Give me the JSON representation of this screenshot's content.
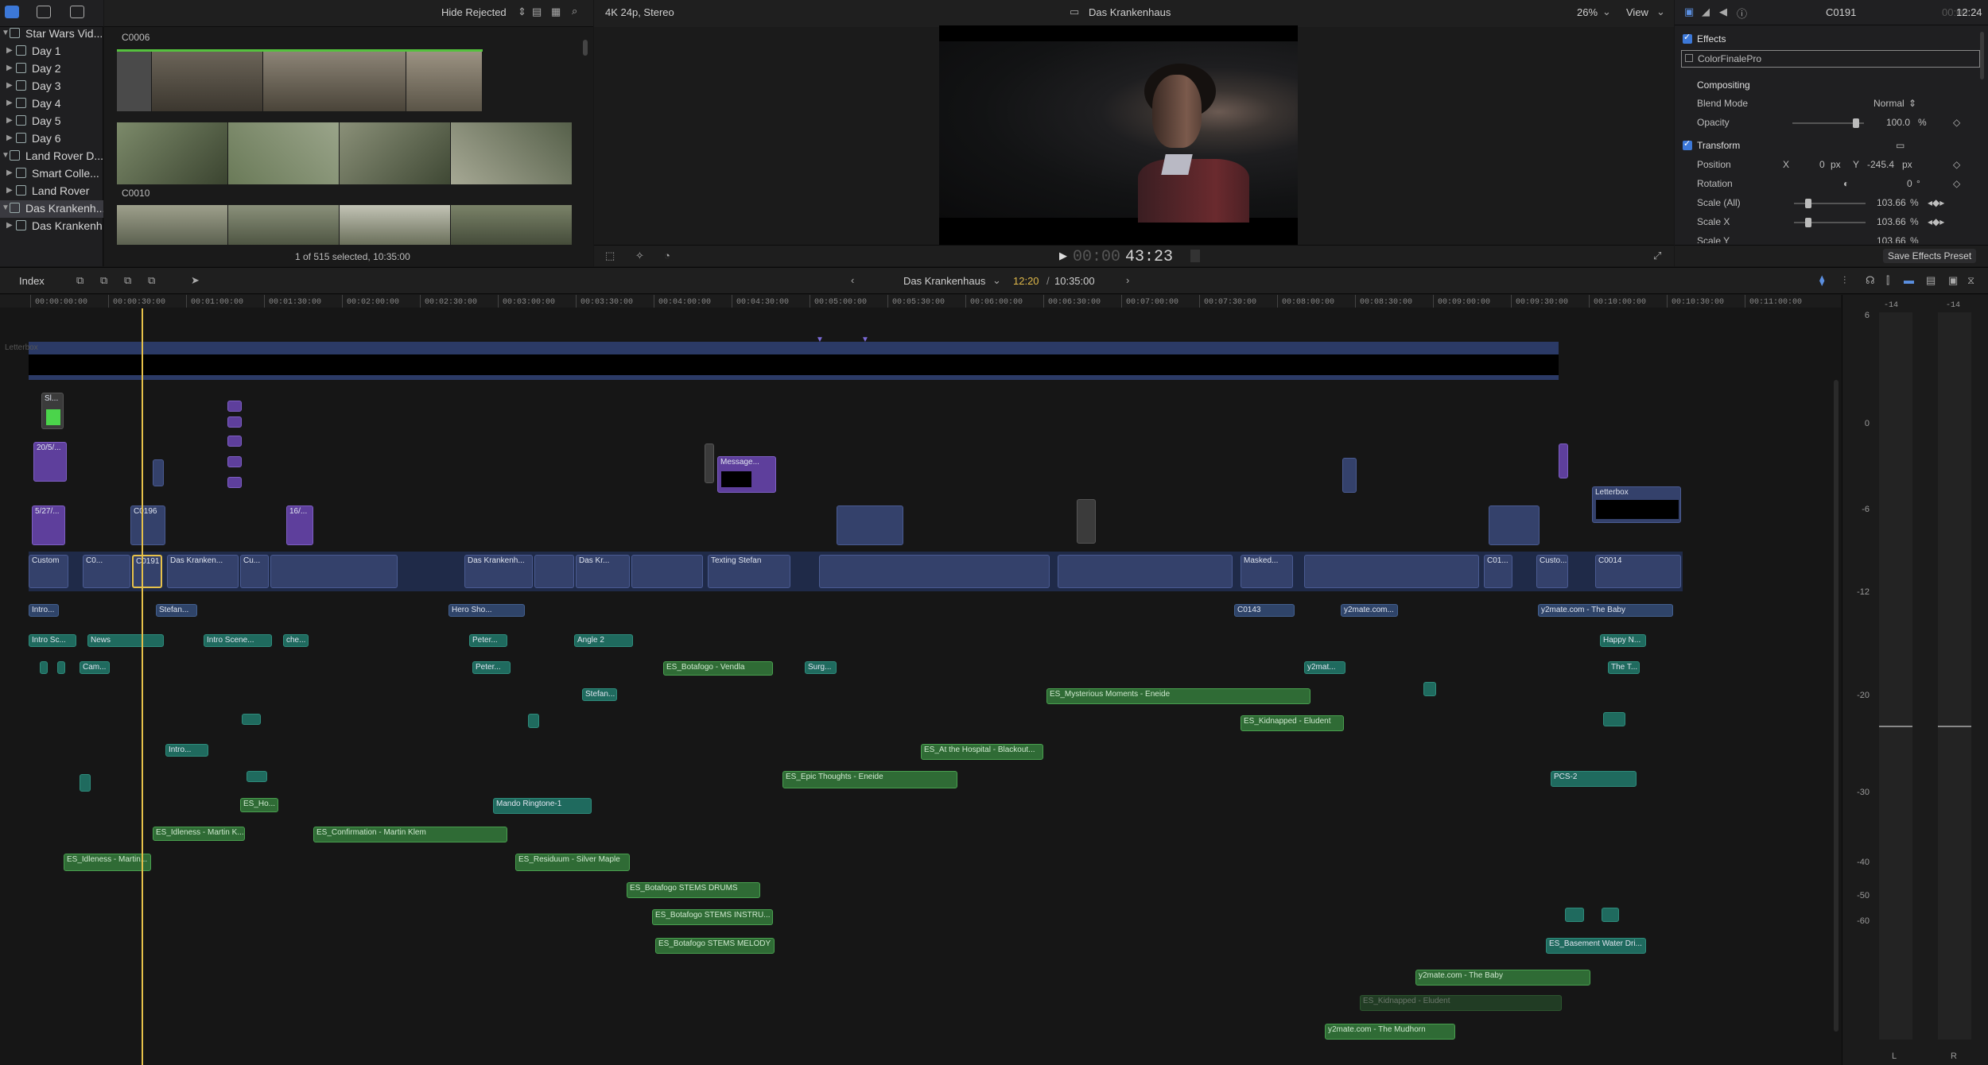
{
  "library": {
    "items": [
      {
        "label": "Star Wars Vid..."
      },
      {
        "label": "Day 1"
      },
      {
        "label": "Day 2"
      },
      {
        "label": "Day 3"
      },
      {
        "label": "Day 4"
      },
      {
        "label": "Day 5"
      },
      {
        "label": "Day 6"
      },
      {
        "label": "Land Rover D..."
      },
      {
        "label": "Smart Colle..."
      },
      {
        "label": "Land Rover"
      },
      {
        "label": "Das Krankenh..."
      },
      {
        "label": "Das Krankenh..."
      }
    ]
  },
  "browser": {
    "filter_label": "Hide Rejected",
    "clip1_name": "C0006",
    "clip2_name": "C0010",
    "status": "1 of 515 selected, 10:35:00"
  },
  "viewer": {
    "format": "4K 24p, Stereo",
    "title": "Das Krankenhaus",
    "zoom": "26%",
    "view_label": "View",
    "timecode_dim": "00:00",
    "timecode": "43:23"
  },
  "inspector": {
    "clip_name": "C0191",
    "duration_dim": "00:00",
    "duration": "12:24",
    "effects_label": "Effects",
    "effect_name": "ColorFinalePro",
    "compositing_label": "Compositing",
    "blend_mode_label": "Blend Mode",
    "blend_mode_value": "Normal",
    "opacity_label": "Opacity",
    "opacity_value": "100.0",
    "opacity_unit": "%",
    "transform_label": "Transform",
    "position_label": "Position",
    "pos_x_label": "X",
    "pos_x_value": "0",
    "pos_y_label": "Y",
    "pos_y_value": "-245.4",
    "pos_unit": "px",
    "rotation_label": "Rotation",
    "rotation_value": "0",
    "rotation_unit": "°",
    "scale_all_label": "Scale (All)",
    "scale_all_value": "103.66",
    "scale_x_label": "Scale X",
    "scale_x_value": "103.66",
    "scale_y_label": "Scale Y",
    "scale_y_value": "103.66",
    "scale_unit": "%",
    "save_preset": "Save Effects Preset"
  },
  "timeline_toolbar": {
    "index_label": "Index",
    "project_name": "Das Krankenhaus",
    "position": "12:20",
    "duration": "10:35:00"
  },
  "ruler": {
    "ticks": [
      "00:00:00:00",
      "00:00:30:00",
      "00:01:00:00",
      "00:01:30:00",
      "00:02:00:00",
      "00:02:30:00",
      "00:03:00:00",
      "00:03:30:00",
      "00:04:00:00",
      "00:04:30:00",
      "00:05:00:00",
      "00:05:30:00",
      "00:06:00:00",
      "00:06:30:00",
      "00:07:00:00",
      "00:07:30:00",
      "00:08:00:00",
      "00:08:30:00",
      "00:09:00:00",
      "00:09:30:00",
      "00:10:00:00",
      "00:10:30:00",
      "00:11:00:00"
    ]
  },
  "timeline": {
    "clips": [
      {
        "label": "Letterbox",
        "kind": "c-gen"
      },
      {
        "label": "Sl...",
        "kind": "c-gen"
      },
      {
        "label": "20/5/...",
        "kind": "c-title"
      },
      {
        "label": "5/27/...",
        "kind": "c-title"
      },
      {
        "label": "C0196",
        "kind": "c-video"
      },
      {
        "label": "16/...",
        "kind": "c-title"
      },
      {
        "label": "Message...",
        "kind": "c-title"
      },
      {
        "label": "Letterbox",
        "kind": "c-gen"
      },
      {
        "label": "Custom",
        "kind": "c-video"
      },
      {
        "label": "C0...",
        "kind": "c-video"
      },
      {
        "label": "C0191",
        "kind": "c-video"
      },
      {
        "label": "Das Kranken...",
        "kind": "c-video"
      },
      {
        "label": "Cu...",
        "kind": "c-video"
      },
      {
        "label": "Das Krankenh...",
        "kind": "c-video"
      },
      {
        "label": "Das Kr...",
        "kind": "c-video"
      },
      {
        "label": "Texting Stefan",
        "kind": "c-video"
      },
      {
        "label": "Masked...",
        "kind": "c-video"
      },
      {
        "label": "C01...",
        "kind": "c-video"
      },
      {
        "label": "Custo...",
        "kind": "c-video"
      },
      {
        "label": "C0014",
        "kind": "c-video"
      },
      {
        "label": "Intro...",
        "kind": "c-vaud"
      },
      {
        "label": "Stefan...",
        "kind": "c-vaud"
      },
      {
        "label": "Hero Sho...",
        "kind": "c-vaud"
      },
      {
        "label": "C0143",
        "kind": "c-vaud"
      },
      {
        "label": "y2mate.com...",
        "kind": "c-vaud"
      },
      {
        "label": "y2mate.com - The Baby",
        "kind": "c-vaud"
      },
      {
        "label": "Intro Sc...",
        "kind": "c-audio"
      },
      {
        "label": "News",
        "kind": "c-audio"
      },
      {
        "label": "Intro Scene...",
        "kind": "c-audio"
      },
      {
        "label": "che...",
        "kind": "c-audio"
      },
      {
        "label": "Peter...",
        "kind": "c-audio"
      },
      {
        "label": "Angle 2",
        "kind": "c-audio"
      },
      {
        "label": "Happy N...",
        "kind": "c-audio"
      },
      {
        "label": "Cam...",
        "kind": "c-audio"
      },
      {
        "label": "Peter...",
        "kind": "c-audio"
      },
      {
        "label": "ES_Botafogo - Vendla",
        "kind": "c-music"
      },
      {
        "label": "Surg...",
        "kind": "c-audio"
      },
      {
        "label": "y2mat...",
        "kind": "c-audio"
      },
      {
        "label": "The T...",
        "kind": "c-audio"
      },
      {
        "label": "Stefan...",
        "kind": "c-audio"
      },
      {
        "label": "ES_Mysterious Moments - Eneide",
        "kind": "c-music"
      },
      {
        "label": "ES_Kidnapped - Eludent",
        "kind": "c-music"
      },
      {
        "label": "Intro...",
        "kind": "c-audio"
      },
      {
        "label": "ES_At the Hospital - Blackout...",
        "kind": "c-music"
      },
      {
        "label": "ES_Epic Thoughts - Eneide",
        "kind": "c-music"
      },
      {
        "label": "PCS-2",
        "kind": "c-audio"
      },
      {
        "label": "ES_Ho...",
        "kind": "c-music"
      },
      {
        "label": "Mando Ringtone-1",
        "kind": "c-audio"
      },
      {
        "label": "ES_Idleness - Martin K...",
        "kind": "c-music"
      },
      {
        "label": "ES_Confirmation - Martin Klem",
        "kind": "c-music"
      },
      {
        "label": "ES_Idleness - Martin...",
        "kind": "c-music"
      },
      {
        "label": "ES_Residuum - Silver Maple",
        "kind": "c-music"
      },
      {
        "label": "ES_Botafogo STEMS DRUMS",
        "kind": "c-music"
      },
      {
        "label": "ES_Botafogo STEMS INSTRU...",
        "kind": "c-music"
      },
      {
        "label": "ES_Botafogo STEMS MELODY",
        "kind": "c-music"
      },
      {
        "label": "ES_Basement Water Dri...",
        "kind": "c-audio"
      },
      {
        "label": "y2mate.com - The Baby",
        "kind": "c-music"
      },
      {
        "label": "ES_Kidnapped - Eludent",
        "kind": "c-music"
      },
      {
        "label": "y2mate.com - The Mudhorn",
        "kind": "c-music"
      }
    ]
  },
  "meters": {
    "left_peak": "-14",
    "right_peak": "-14",
    "scale": [
      "6",
      "0",
      "-6",
      "-12",
      "-20",
      "-30",
      "-40",
      "-50",
      "-60"
    ],
    "channels": [
      "L",
      "R"
    ]
  }
}
